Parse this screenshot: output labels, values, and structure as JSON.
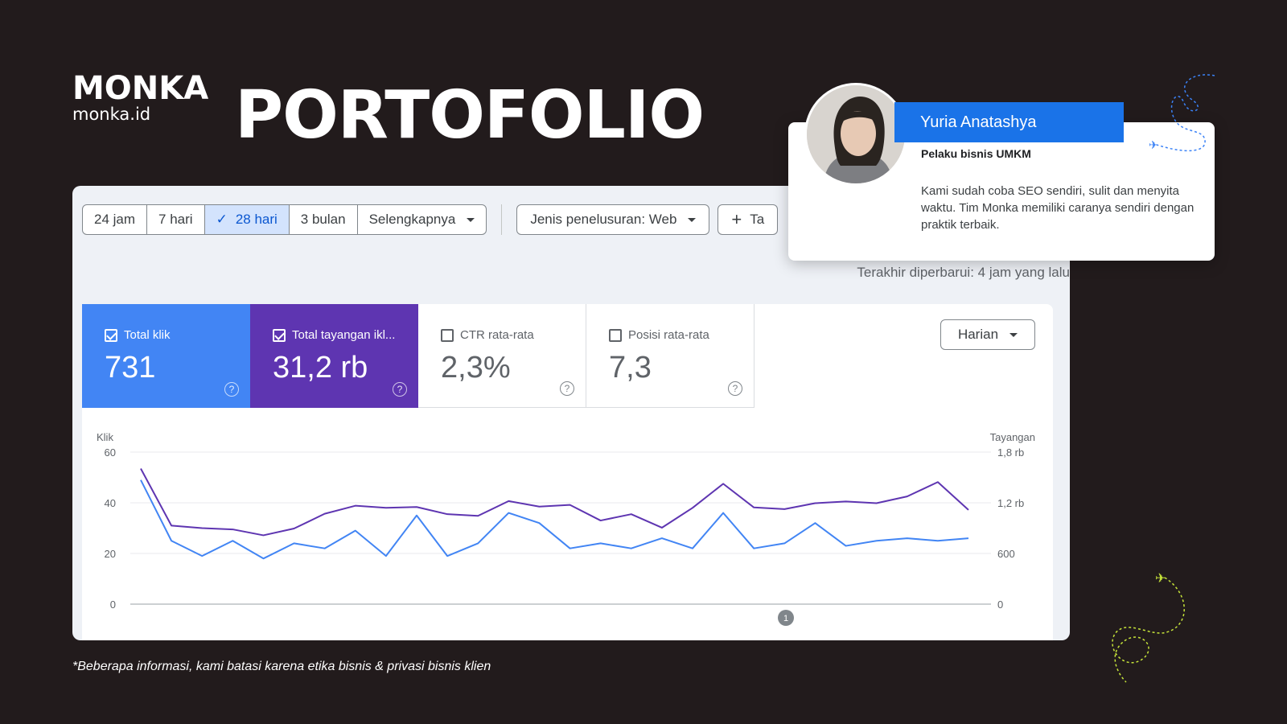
{
  "brand": {
    "logo": "MONKA",
    "url": "monka.id"
  },
  "page_title": "PORTOFOLIO",
  "filters": {
    "periods": [
      "24 jam",
      "7 hari",
      "28 hari",
      "3 bulan"
    ],
    "active_period": "28 hari",
    "more": "Selengkapnya",
    "search_type": "Jenis penelusuran: Web",
    "add_filter": "Ta"
  },
  "last_updated": "Terakhir diperbarui: 4 jam yang lalu",
  "metrics": {
    "total_clicks": {
      "label": "Total klik",
      "value": "731"
    },
    "total_impressions": {
      "label": "Total tayangan ikl...",
      "value": "31,2 rb"
    },
    "avg_ctr": {
      "label": "CTR rata-rata",
      "value": "2,3%"
    },
    "avg_position": {
      "label": "Posisi rata-rata",
      "value": "7,3"
    }
  },
  "granularity": "Harian",
  "chart_data": {
    "type": "line",
    "x": [
      1,
      2,
      3,
      4,
      5,
      6,
      7,
      8,
      9,
      10,
      11,
      12,
      13,
      14,
      15,
      16,
      17,
      18,
      19,
      20,
      21,
      22,
      23,
      24,
      25,
      26,
      27,
      28
    ],
    "ylabel": "Klik",
    "ylabel_right": "Tayangan",
    "ylim": [
      0,
      60
    ],
    "ylim_right": [
      0,
      1800
    ],
    "yticks": [
      "0",
      "20",
      "40",
      "60"
    ],
    "yticks_right": [
      "0",
      "600",
      "1,2 rb",
      "1,8 rb"
    ],
    "annotation": "1",
    "series": [
      {
        "name": "Total klik",
        "axis": "left",
        "color": "#4285f4",
        "values": [
          49,
          25,
          19,
          25,
          18,
          24,
          22,
          29,
          19,
          35,
          19,
          24,
          36,
          32,
          22,
          24,
          22,
          26,
          22,
          36,
          22,
          24,
          32,
          23,
          25,
          26,
          25,
          26
        ]
      },
      {
        "name": "Total tayangan iklan",
        "axis": "right",
        "color": "#5e35b1",
        "values": [
          1605,
          930,
          900,
          885,
          815,
          895,
          1070,
          1165,
          1140,
          1150,
          1065,
          1045,
          1220,
          1155,
          1175,
          990,
          1065,
          905,
          1140,
          1425,
          1145,
          1125,
          1195,
          1215,
          1195,
          1275,
          1445,
          1115
        ]
      }
    ]
  },
  "testimonial": {
    "name": "Yuria Anatashya",
    "role": "Pelaku bisnis UMKM",
    "quote": "Kami sudah coba SEO sendiri, sulit dan menyita waktu. Tim Monka memiliki caranya sendiri dengan praktik terbaik."
  },
  "footnote": "*Beberapa informasi, kami batasi karena etika bisnis & privasi bisnis klien",
  "colors": {
    "background": "#221b1c",
    "clicks": "#4285f4",
    "impressions": "#5e35b1",
    "accent_blue": "#1a73e8",
    "accent_lime": "#c6e43a"
  },
  "icons": [
    "check-icon",
    "caret-down-icon",
    "plus-icon",
    "checkbox-icon",
    "help-icon",
    "airplane-icon"
  ]
}
